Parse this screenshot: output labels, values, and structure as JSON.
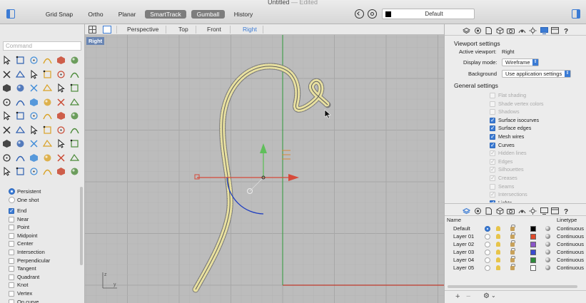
{
  "window": {
    "title": "Untitled",
    "separator": "—",
    "status": "Edited"
  },
  "toolbar": {
    "buttons": [
      {
        "label": "Grid Snap",
        "on": false
      },
      {
        "label": "Ortho",
        "on": false
      },
      {
        "label": "Planar",
        "on": false
      },
      {
        "label": "SmartTrack",
        "on": true
      },
      {
        "label": "Gumball",
        "on": true
      },
      {
        "label": "History",
        "on": false
      }
    ],
    "current_layer": "Default",
    "current_layer_color": "#000000"
  },
  "command": {
    "placeholder": "Command"
  },
  "osnap": {
    "modes": [
      {
        "label": "Persistent",
        "selected": true
      },
      {
        "label": "One shot",
        "selected": false
      }
    ],
    "items": [
      {
        "label": "End",
        "checked": true
      },
      {
        "label": "Near",
        "checked": false
      },
      {
        "label": "Point",
        "checked": false
      },
      {
        "label": "Midpoint",
        "checked": false
      },
      {
        "label": "Center",
        "checked": false
      },
      {
        "label": "Intersection",
        "checked": false
      },
      {
        "label": "Perpendicular",
        "checked": false
      },
      {
        "label": "Tangent",
        "checked": false
      },
      {
        "label": "Quadrant",
        "checked": false
      },
      {
        "label": "Knot",
        "checked": false
      },
      {
        "label": "Vertex",
        "checked": false
      },
      {
        "label": "On curve",
        "checked": false
      }
    ]
  },
  "viewport": {
    "tabs": [
      {
        "label": "Perspective",
        "active": false
      },
      {
        "label": "Top",
        "active": false
      },
      {
        "label": "Front",
        "active": false
      },
      {
        "label": "Right",
        "active": true
      }
    ],
    "label": "Right",
    "axis_labels": {
      "z": "z",
      "y": "y"
    },
    "colors": {
      "background": "#bcbcbc",
      "grid_minor": "#b3b3b3",
      "grid_major": "#a6a6a6",
      "x_axis": "#c0392b",
      "y_axis": "#2e9a3a",
      "curve": "#7c7c7c",
      "curve_iso": "#e8e0a0",
      "arc": "#1f3ec0"
    }
  },
  "viewport_settings": {
    "title": "Viewport settings",
    "active_viewport_label": "Active viewport:",
    "active_viewport": "Right",
    "display_mode_label": "Display mode:",
    "display_mode": "Wireframe",
    "background_label": "Background",
    "background": "Use application settings"
  },
  "general_settings": {
    "title": "General settings",
    "items": [
      {
        "label": "Flat shading",
        "checked": false,
        "enabled": false
      },
      {
        "label": "Shade vertex colors",
        "checked": false,
        "enabled": false
      },
      {
        "label": "Shadows",
        "checked": false,
        "enabled": false
      },
      {
        "label": "Surface isocurves",
        "checked": true,
        "enabled": true
      },
      {
        "label": "Surface edges",
        "checked": true,
        "enabled": true
      },
      {
        "label": "Mesh wires",
        "checked": true,
        "enabled": true
      },
      {
        "label": "Curves",
        "checked": true,
        "enabled": true
      },
      {
        "label": "Hidden lines",
        "checked": true,
        "enabled": false
      },
      {
        "label": "Edges",
        "checked": true,
        "enabled": false
      },
      {
        "label": "Silhouettes",
        "checked": true,
        "enabled": false
      },
      {
        "label": "Creases",
        "checked": true,
        "enabled": false
      },
      {
        "label": "Seams",
        "checked": false,
        "enabled": false
      },
      {
        "label": "Intersections",
        "checked": true,
        "enabled": false
      },
      {
        "label": "Lights",
        "checked": true,
        "enabled": true
      }
    ]
  },
  "layers": {
    "columns": {
      "name": "Name",
      "linetype": "Linetype"
    },
    "rows": [
      {
        "name": "Default",
        "current": true,
        "color": "#000000",
        "linetype": "Continuous"
      },
      {
        "name": "Layer 01",
        "current": false,
        "color": "#e04a2a",
        "linetype": "Continuous"
      },
      {
        "name": "Layer 02",
        "current": false,
        "color": "#8a55c8",
        "linetype": "Continuous"
      },
      {
        "name": "Layer 03",
        "current": false,
        "color": "#3a4ad0",
        "linetype": "Continuous"
      },
      {
        "name": "Layer 04",
        "current": false,
        "color": "#2e8a3a",
        "linetype": "Continuous"
      },
      {
        "name": "Layer 05",
        "current": false,
        "color": "#ffffff",
        "linetype": "Continuous"
      }
    ],
    "footer": {
      "add": "+",
      "remove": "−",
      "gear": "⚙",
      "chevron": "⌄"
    }
  }
}
